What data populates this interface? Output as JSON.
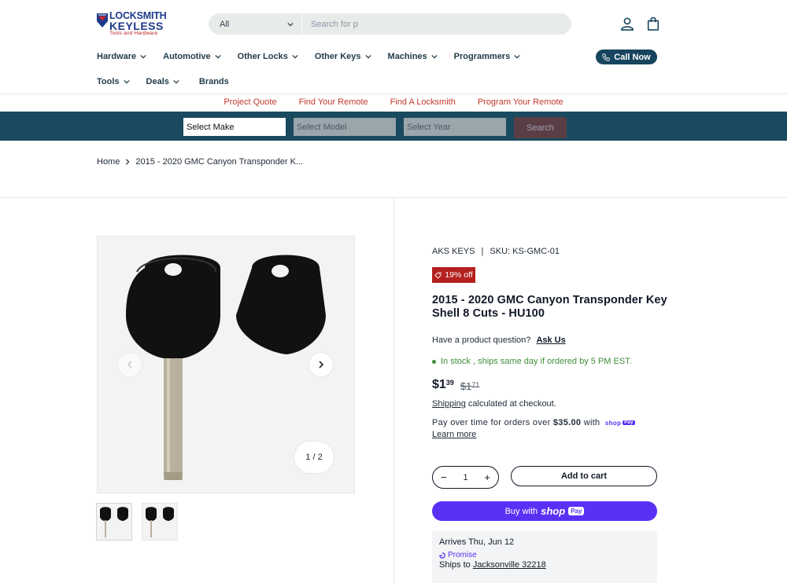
{
  "logo": {
    "line1": "LOCKSMITH",
    "line2": "KEYLESS",
    "line3": "Tools and Hardware"
  },
  "search": {
    "category": "All",
    "placeholder": "Search for p"
  },
  "nav": {
    "row1": [
      "Hardware",
      "Automotive",
      "Other Locks",
      "Other Keys",
      "Machines",
      "Programmers"
    ],
    "row2": [
      "Tools",
      "Deals"
    ],
    "brands": "Brands",
    "call_now": "Call Now"
  },
  "quick_links": [
    "Project Quote",
    "Find Your Remote",
    "Find A Locksmith",
    "Program Your Remote"
  ],
  "selector": {
    "make": "Select Make",
    "model": "Select Model",
    "year": "Select Year",
    "search": "Search"
  },
  "breadcrumb": {
    "home": "Home",
    "current": "2015 - 2020 GMC Canyon Transponder K..."
  },
  "gallery": {
    "counter": "1 / 2"
  },
  "product": {
    "vendor": "AKS KEYS",
    "sku": "SKU: KS-GMC-01",
    "badge": "19% off",
    "title": "2015 - 2020 GMC Canyon Transponder Key Shell 8 Cuts - HU100",
    "question": "Have a product question?",
    "ask_us": "Ask Us",
    "stock": "In stock , ships same day if ordered by 5 PM EST.",
    "price_now_int": "$1",
    "price_now_cents": "39",
    "price_was_int": "$1",
    "price_was_cents": "71",
    "shipping_link": "Shipping",
    "shipping_text": "calculated at checkout.",
    "pay_over_pre": "Pay over time for orders over",
    "pay_over_amount": "$35.00",
    "pay_over_post": "with",
    "learn_more": "Learn more",
    "quantity": "1",
    "add_to_cart": "Add to cart",
    "buy_with": "Buy with",
    "shop": "shop",
    "pay": "Pay"
  },
  "promise": {
    "arrives": "Arrives Thu, Jun 12",
    "promise_label": "Promise",
    "ships_to": "Ships to",
    "location": "Jacksonville 32218"
  },
  "colors": {
    "brand": "#17455e",
    "accent_red": "#b3201f",
    "shop_pay": "#5a31f4",
    "link_red": "#c0392b"
  }
}
